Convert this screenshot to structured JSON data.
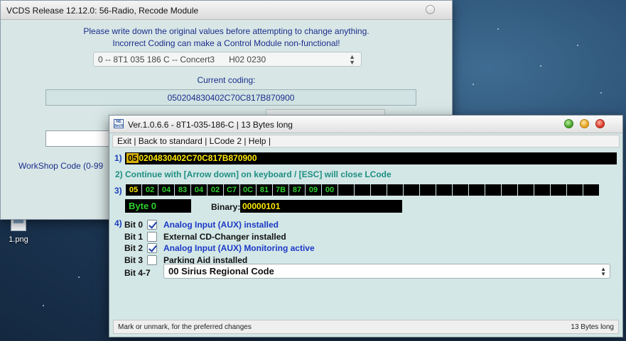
{
  "desktop": {
    "icon_label": "1.png"
  },
  "vcds": {
    "title": "VCDS Release 12.12.0: 56-Radio,  Recode Module",
    "warning_line1": "Please write down the original values before attempting to change anything.",
    "warning_line2": "Incorrect Coding can make a Control Module non-functional!",
    "module_select": "0 -- 8T1 035 186 C -- Concert3      H02 0230",
    "current_coding_label": "Current coding:",
    "current_coding_value": "050204830402C70C817B870900",
    "workshop_label": "WorkShop Code (0-99"
  },
  "lcode": {
    "title": "Ver.1.0.6.6 -   8T1-035-186-C | 13 Bytes long",
    "logo_text": "NE tech",
    "menu": [
      "Exit |",
      " Back to standard |",
      " LCode 2 |",
      " Help |"
    ],
    "step1_num": "1)",
    "coding_highlight": "05",
    "coding_rest": "0204830402C70C817B870900",
    "step2_text": "2) Continue with [Arrow down] on keyboard / [ESC] will close LCode",
    "step3_num": "3)",
    "bytes": [
      "05",
      "02",
      "04",
      "83",
      "04",
      "02",
      "C7",
      "0C",
      "81",
      "7B",
      "87",
      "09",
      "00",
      "",
      "",
      "",
      "",
      "",
      "",
      "",
      "",
      "",
      "",
      "",
      "",
      "",
      "",
      "",
      ""
    ],
    "byte_label": "Byte 0",
    "binary_label": "Binary:",
    "binary_value": "00000101",
    "step4_num": "4)",
    "bits": [
      {
        "bit": "Bit 0",
        "checked": true,
        "desc": "Analog Input (AUX) installed"
      },
      {
        "bit": "Bit 1",
        "checked": false,
        "desc": "External CD-Changer installed"
      },
      {
        "bit": "Bit 2",
        "checked": true,
        "desc": "Analog Input (AUX) Monitoring active"
      },
      {
        "bit": "Bit 3",
        "checked": false,
        "desc": "Parking Aid installed"
      }
    ],
    "bit47_label": "Bit 4-7",
    "region_select": "00 Sirius Regional Code",
    "status_left": "Mark or unmark, for the preferred changes",
    "status_right": "13 Bytes long"
  },
  "colors": {
    "panel_bg": "#d3e7e6",
    "label_blue": "#1b2d8c",
    "byte_green": "#2fd12f",
    "byte_yellow": "#ffe900"
  }
}
